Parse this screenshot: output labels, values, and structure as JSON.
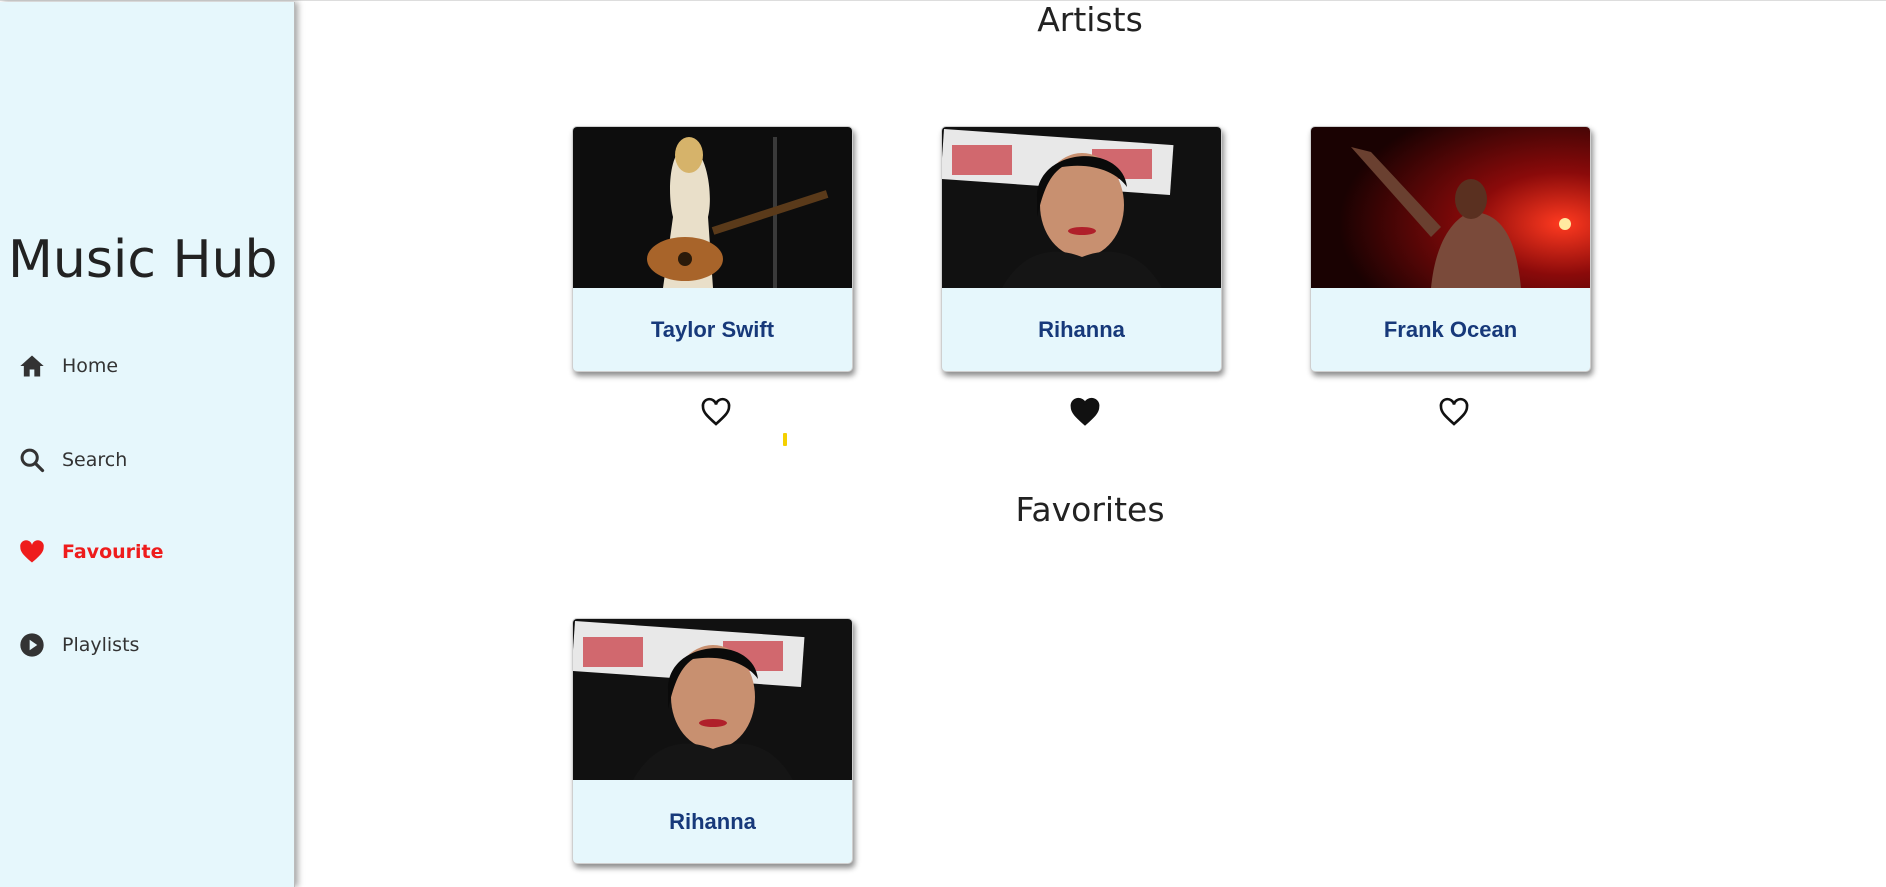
{
  "app": {
    "title": "Music Hub"
  },
  "sidebar": {
    "items": [
      {
        "label": "Home",
        "icon": "home-icon",
        "active": false
      },
      {
        "label": "Search",
        "icon": "search-icon",
        "active": false
      },
      {
        "label": "Favourite",
        "icon": "heart-icon",
        "active": true
      },
      {
        "label": "Playlists",
        "icon": "play-circle-icon",
        "active": false
      }
    ]
  },
  "main": {
    "artists_title": "Artists",
    "artists": [
      {
        "name": "Taylor Swift",
        "favorited": false
      },
      {
        "name": "Rihanna",
        "favorited": true
      },
      {
        "name": "Frank Ocean",
        "favorited": false
      }
    ],
    "favorites_title": "Favorites",
    "favorites": [
      {
        "name": "Rihanna"
      }
    ]
  },
  "colors": {
    "sidebar_bg": "#e6f7fc",
    "active_nav": "#ee1c1c",
    "card_name": "#17397a",
    "card_bg": "#e6f7fc"
  }
}
